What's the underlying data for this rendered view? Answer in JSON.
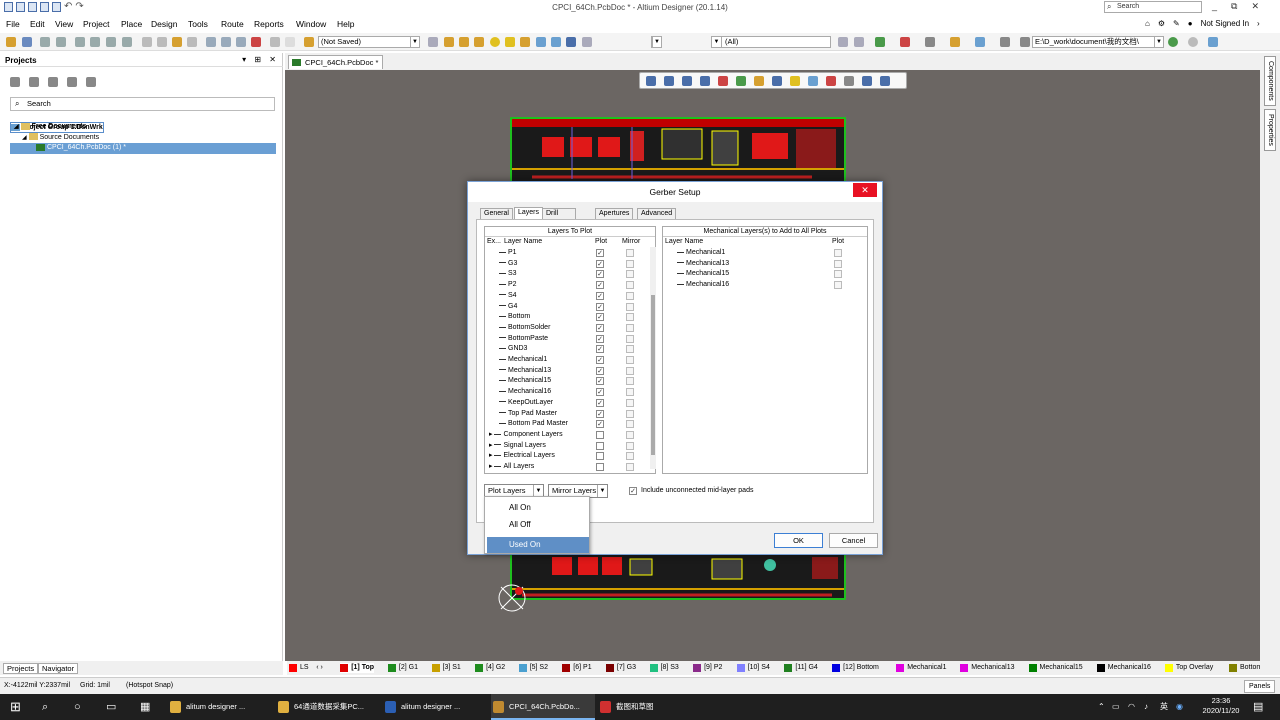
{
  "window": {
    "title": "CPCI_64Ch.PcbDoc * - Altium Designer (20.1.14)",
    "search_placeholder": "Search",
    "minimize": "_",
    "restore": "⧉",
    "close": "✕"
  },
  "menu": [
    "File",
    "Edit",
    "View",
    "Project",
    "Place",
    "Design",
    "Tools",
    "Route",
    "Reports",
    "Window",
    "Help"
  ],
  "topright": {
    "signin": "Not Signed In"
  },
  "toolbar": {
    "not_saved": "(Not Saved)",
    "all": "(All)",
    "path": "E:\\D_work\\document\\我的文档\\"
  },
  "projects_panel": {
    "title": "Projects",
    "search_placeholder": "Search",
    "tree": [
      {
        "label": "Project Group 1.DsnWrk"
      },
      {
        "label": "Free Documents"
      },
      {
        "label": "Source Documents"
      },
      {
        "label": "CPCI_64Ch.PcbDoc (1) *"
      }
    ],
    "tabs": [
      "Projects",
      "Navigator"
    ]
  },
  "doc_tab": "CPCI_64Ch.PcbDoc *",
  "right_panels": [
    "Components",
    "Properties"
  ],
  "dialog": {
    "title": "Gerber Setup",
    "tabs": [
      "General",
      "Layers",
      "Drill Drawing",
      "Apertures",
      "Advanced"
    ],
    "left_group": {
      "title": "Layers To Plot",
      "cols": [
        "Ex...",
        "Layer Name",
        "Plot",
        "Mirror"
      ],
      "rows": [
        {
          "name": "P1",
          "plot": true
        },
        {
          "name": "G3",
          "plot": true
        },
        {
          "name": "S3",
          "plot": true
        },
        {
          "name": "P2",
          "plot": true
        },
        {
          "name": "S4",
          "plot": true
        },
        {
          "name": "G4",
          "plot": true
        },
        {
          "name": "Bottom",
          "plot": true
        },
        {
          "name": "BottomSolder",
          "plot": true
        },
        {
          "name": "BottomPaste",
          "plot": true
        },
        {
          "name": "GND3",
          "plot": true
        },
        {
          "name": "Mechanical1",
          "plot": true
        },
        {
          "name": "Mechanical13",
          "plot": true
        },
        {
          "name": "Mechanical15",
          "plot": true
        },
        {
          "name": "Mechanical16",
          "plot": true
        },
        {
          "name": "KeepOutLayer",
          "plot": true
        },
        {
          "name": "Top Pad Master",
          "plot": true
        },
        {
          "name": "Bottom Pad Master",
          "plot": true
        },
        {
          "name": "Component Layers",
          "plot": false,
          "group": true
        },
        {
          "name": "Signal Layers",
          "plot": false,
          "group": true
        },
        {
          "name": "Electrical Layers",
          "plot": false,
          "group": true
        },
        {
          "name": "All Layers",
          "plot": false,
          "group": true
        }
      ]
    },
    "right_group": {
      "title": "Mechanical Layers(s) to Add to All Plots",
      "cols": [
        "Layer Name",
        "Plot"
      ],
      "rows": [
        "Mechanical1",
        "Mechanical13",
        "Mechanical15",
        "Mechanical16"
      ]
    },
    "plot_layers_btn": "Plot Layers",
    "mirror_layers_btn": "Mirror Layers",
    "include_label": "Include unconnected mid-layer pads",
    "menu_items": [
      "All On",
      "All Off",
      "Used On"
    ],
    "ok": "OK",
    "cancel": "Cancel"
  },
  "layer_tabs": [
    {
      "label": "LS",
      "color": "#ff0000"
    },
    {
      "label": "[1] Top",
      "color": "#e00000"
    },
    {
      "label": "[2] G1",
      "color": "#1e8c1e"
    },
    {
      "label": "[3] S1",
      "color": "#c8a000"
    },
    {
      "label": "[4] G2",
      "color": "#1e8c1e"
    },
    {
      "label": "[5] S2",
      "color": "#4aa0d0"
    },
    {
      "label": "[6] P1",
      "color": "#a00000"
    },
    {
      "label": "[7] G3",
      "color": "#7a0000"
    },
    {
      "label": "[8] S3",
      "color": "#20c080"
    },
    {
      "label": "[9] P2",
      "color": "#8a2a8a"
    },
    {
      "label": "[10] S4",
      "color": "#8080ff"
    },
    {
      "label": "[11] G4",
      "color": "#208020"
    },
    {
      "label": "[12] Bottom",
      "color": "#0000e0"
    },
    {
      "label": "Mechanical1",
      "color": "#e000e0"
    },
    {
      "label": "Mechanical13",
      "color": "#e000e0"
    },
    {
      "label": "Mechanical15",
      "color": "#008000"
    },
    {
      "label": "Mechanical16",
      "color": "#000000"
    },
    {
      "label": "Top Overlay",
      "color": "#ffff00"
    },
    {
      "label": "Bottom Overlay",
      "color": "#808000"
    }
  ],
  "status": {
    "coords": "X:-4122mil Y:2337mil",
    "grid": "Grid: 1mil",
    "snap": "(Hotspot Snap)",
    "panels": "Panels"
  },
  "taskbar": {
    "items": [
      "alitum designer ...",
      "64通道数据采集PC...",
      "alitum designer ...",
      "CPCI_64Ch.PcbDo...",
      "截图和草图"
    ],
    "time": "23:36",
    "date": "2020/11/20",
    "lang": "英"
  }
}
